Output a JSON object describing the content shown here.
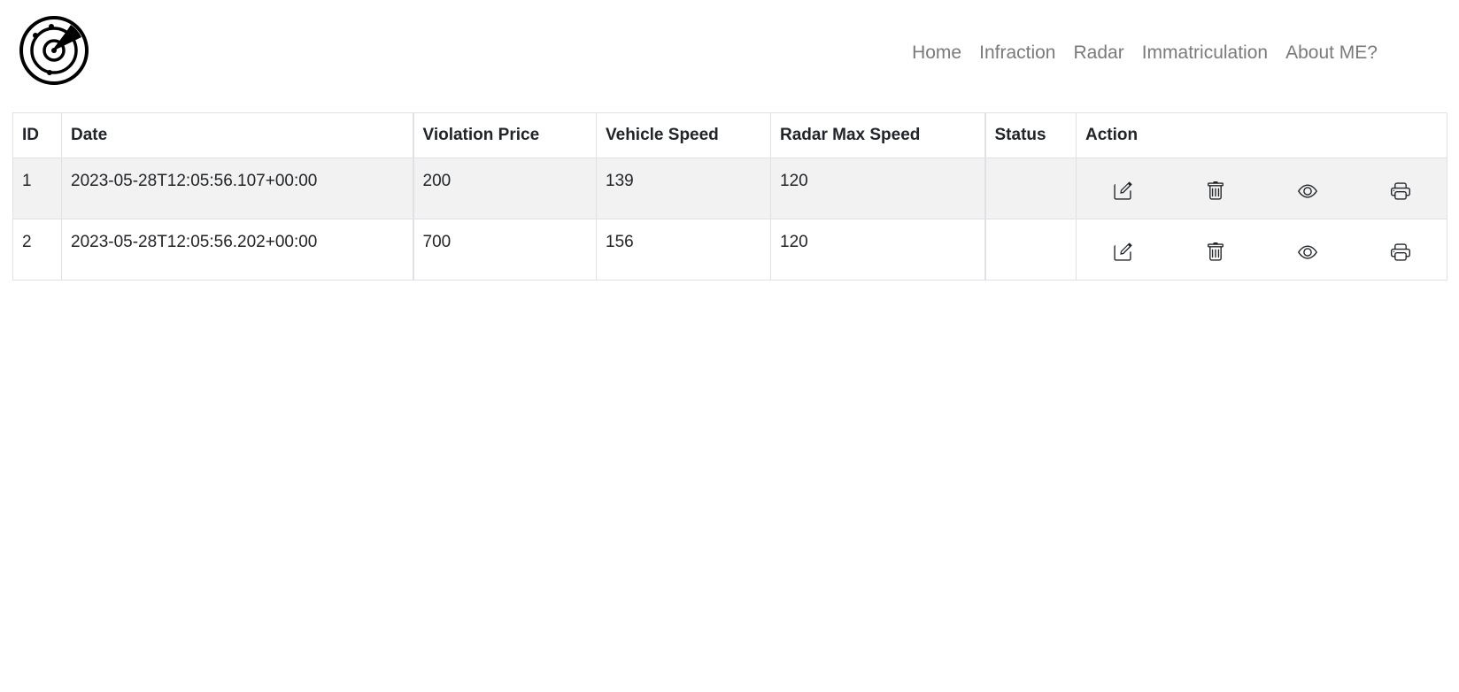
{
  "nav": {
    "items": [
      {
        "label": "Home"
      },
      {
        "label": "Infraction"
      },
      {
        "label": "Radar"
      },
      {
        "label": "Immatriculation"
      },
      {
        "label": "About ME?"
      }
    ]
  },
  "table": {
    "headers": {
      "id": "ID",
      "date": "Date",
      "violation_price": "Violation Price",
      "vehicle_speed": "Vehicle Speed",
      "radar_max_speed": "Radar Max Speed",
      "status": "Status",
      "action": "Action"
    },
    "rows": [
      {
        "id": "1",
        "date": "2023-05-28T12:05:56.107+00:00",
        "violation_price": "200",
        "vehicle_speed": "139",
        "radar_max_speed": "120",
        "status": ""
      },
      {
        "id": "2",
        "date": "2023-05-28T12:05:56.202+00:00",
        "violation_price": "700",
        "vehicle_speed": "156",
        "radar_max_speed": "120",
        "status": ""
      }
    ],
    "actions": [
      "edit-icon",
      "trash-icon",
      "eye-icon",
      "printer-icon"
    ]
  },
  "colors": {
    "nav_text": "#7a7a7a",
    "row_stripe": "#f2f2f2",
    "border": "#dee2e6"
  }
}
